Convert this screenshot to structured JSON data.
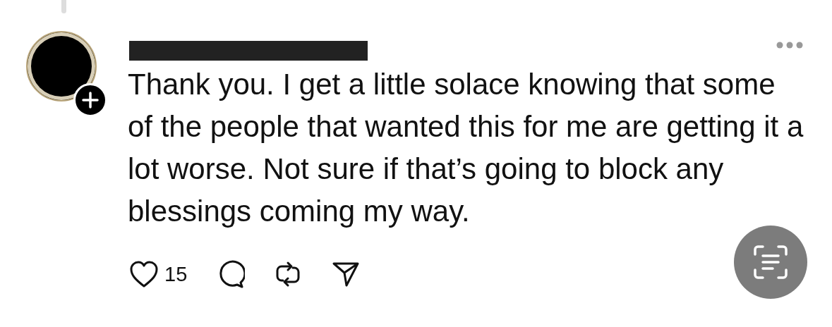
{
  "post": {
    "text": "Thank you. I get a little solace knowing that some of the people that wanted this for me are getting it a lot worse. Not sure if that’s going to block any blessings coming my way.",
    "like_count": "15"
  },
  "actions": [
    {
      "kind": "like"
    },
    {
      "kind": "comment"
    },
    {
      "kind": "repost"
    },
    {
      "kind": "share"
    }
  ]
}
